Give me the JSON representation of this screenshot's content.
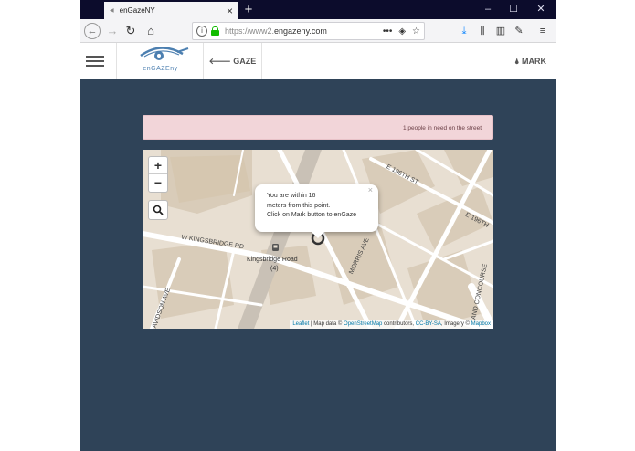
{
  "browser": {
    "tab_title": "enGazeNY",
    "tab_close": "×",
    "new_tab": "+",
    "window_controls": [
      "–",
      "☐",
      "✕"
    ],
    "url_prefix": "https://www2.",
    "url_host": "engazeny.com",
    "url_actions": [
      "•••",
      "◈",
      "☆"
    ]
  },
  "site": {
    "logo_text": "enGAZEny",
    "gaze_label": "🡐 GAZE",
    "mark_label": "🌢 MARK"
  },
  "alert": {
    "text": "1 people in need on the street"
  },
  "map": {
    "zoom_in": "+",
    "zoom_out": "−",
    "popup": {
      "close": "×",
      "line1": "You are within 16",
      "line2": "meters from this point.",
      "line3": "Click on Mark button to enGaze"
    },
    "labels": {
      "kingsbridge_rd": "W KINGSBRIDGE RD",
      "kingsbridge_road_station": "Kingsbridge Road",
      "station_line": "(4)",
      "morris_ave": "MORRIS AVE",
      "e196": "E 196TH ST",
      "e196_right": "E 196TH",
      "grand_concourse": "AND CONCOURSE",
      "davidson_ave": "AVIDSON AVE"
    },
    "attribution": {
      "leaflet": "Leaflet",
      "sep": " | Map data © ",
      "osm": "OpenStreetMap",
      "contrib": " contributors, ",
      "license": "CC-BY-SA",
      "imagery": ", Imagery © ",
      "mapbox": "Mapbox"
    }
  }
}
